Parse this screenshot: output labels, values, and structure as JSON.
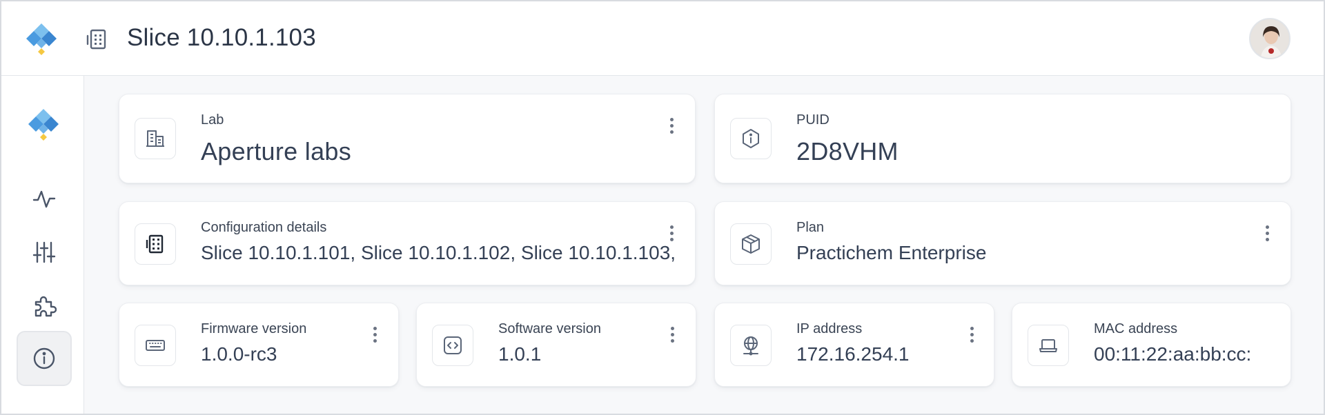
{
  "header": {
    "title": "Slice 10.10.1.103",
    "logo_icon": "diamond-logo-icon",
    "title_icon": "building-grid-icon",
    "avatar_icon": "user-avatar"
  },
  "sidebar": {
    "items": [
      {
        "name": "activity",
        "icon": "activity-icon",
        "active": false
      },
      {
        "name": "settings",
        "icon": "sliders-icon",
        "active": false
      },
      {
        "name": "extensions",
        "icon": "puzzle-icon",
        "active": false
      },
      {
        "name": "info",
        "icon": "info-icon",
        "active": true
      }
    ]
  },
  "cards": {
    "lab": {
      "label": "Lab",
      "value": "Aperture labs",
      "icon": "building-icon"
    },
    "puid": {
      "label": "PUID",
      "value": "2D8VHM",
      "icon": "hexagon-info-icon"
    },
    "configuration": {
      "label": "Configuration details",
      "value": "Slice 10.10.1.101, Slice 10.10.1.102, Slice 10.10.1.103,...",
      "icon": "device-grid-icon"
    },
    "plan": {
      "label": "Plan",
      "value": "Practichem Enterprise",
      "icon": "package-icon"
    },
    "firmware": {
      "label": "Firmware version",
      "value": "1.0.0-rc3",
      "icon": "keyboard-icon"
    },
    "software": {
      "label": "Software version",
      "value": "1.0.1",
      "icon": "code-icon"
    },
    "ip": {
      "label": "IP address",
      "value": "172.16.254.1",
      "icon": "globe-network-icon"
    },
    "mac": {
      "label": "MAC address",
      "value": "00:11:22:aa:bb:cc:",
      "icon": "laptop-icon"
    }
  },
  "colors": {
    "logo_blue": "#3d8fd6",
    "logo_light": "#8cc7f0",
    "logo_yellow": "#f5c842",
    "text": "#344055"
  }
}
